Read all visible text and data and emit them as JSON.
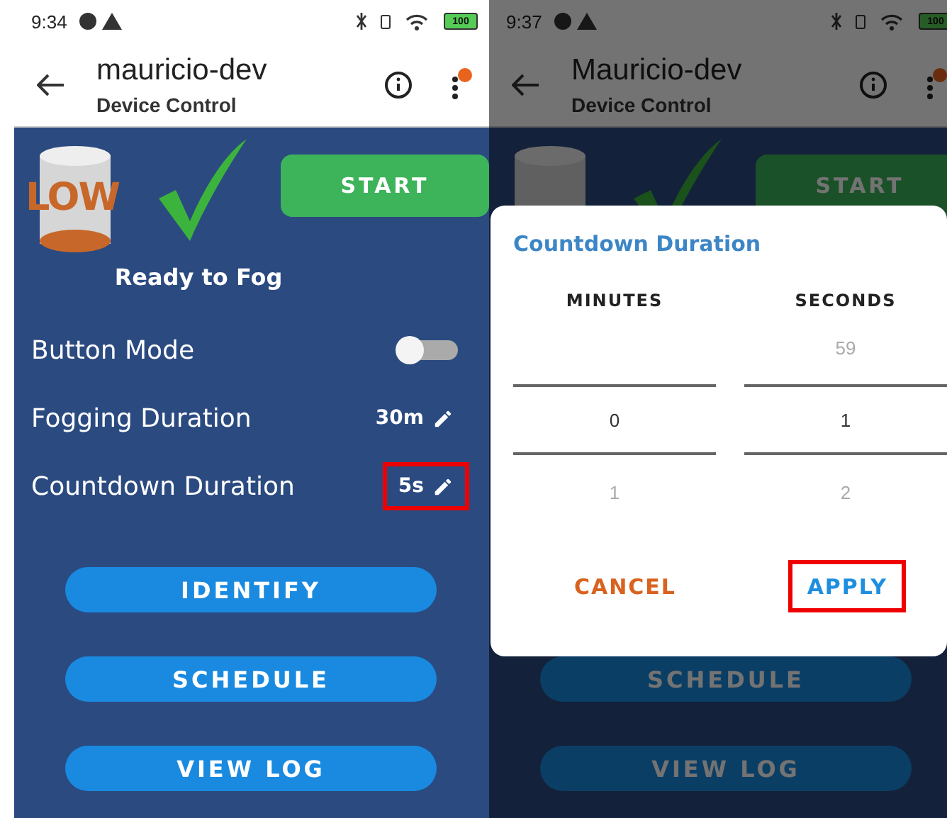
{
  "screens": [
    {
      "status_bar": {
        "time": "9:34",
        "battery": "100"
      },
      "header": {
        "title": "mauricio-dev",
        "subtitle": "Device Control",
        "notification_dot": true
      },
      "hero": {
        "tank_level": "LOW",
        "start_button": "START",
        "status": "Ready to Fog"
      },
      "settings": [
        {
          "kind": "toggle",
          "label": "Button Mode",
          "on": false
        },
        {
          "kind": "value",
          "label": "Fogging Duration",
          "value": "30m",
          "highlighted": false
        },
        {
          "kind": "value",
          "label": "Countdown Duration",
          "value": "5s",
          "highlighted": true
        }
      ],
      "buttons": [
        "IDENTIFY",
        "SCHEDULE",
        "VIEW LOG"
      ]
    },
    {
      "status_bar": {
        "time": "9:37",
        "battery": "100"
      },
      "header": {
        "title": "Mauricio-dev",
        "subtitle": "Device Control",
        "notification_dot": true
      },
      "hero": {
        "start_button": "START"
      },
      "buttons": [
        "SCHEDULE",
        "VIEW LOG"
      ],
      "dialog": {
        "title": "Countdown Duration",
        "pickers": [
          {
            "label": "MINUTES",
            "selected_value": "0",
            "next": "1"
          },
          {
            "label": "SECONDS",
            "previous": "59",
            "selected_value": "1",
            "next": "2"
          }
        ],
        "actions": [
          {
            "kind": "cancel",
            "label": "CANCEL",
            "highlighted": false
          },
          {
            "kind": "confirm",
            "label": "APPLY",
            "highlighted": true
          }
        ]
      }
    }
  ]
}
